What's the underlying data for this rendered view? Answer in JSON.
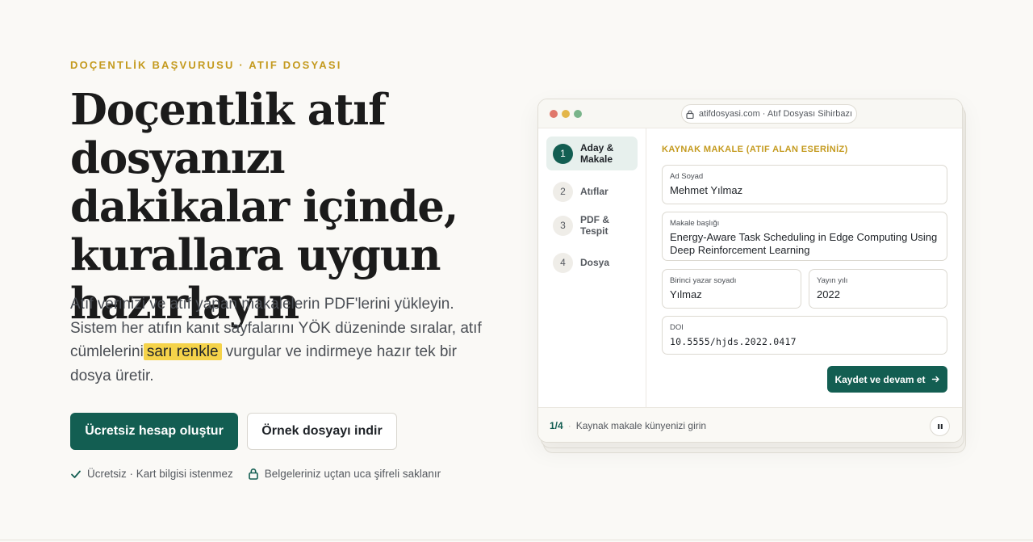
{
  "hero": {
    "eyebrow": "DOÇENTLİK BAŞVURUSU · ATIF DOSYASI",
    "headline": "Doçentlik atıf dosyanızı dakikalar içinde, kurallara uygun hazırlayın",
    "lead_before": "Atıf verinizi ve atıf yapan makalelerin PDF'lerini yükleyin. Sistem her atıfın kanıt sayfalarını YÖK düzeninde sıralar, atıf cümlelerini",
    "lead_highlight": "sarı renkle",
    "lead_after": " vurgular ve indirmeye hazır tek bir dosya üretir.",
    "primary_cta": "Ücretsiz hesap oluştur",
    "secondary_cta": "Örnek dosyayı indir",
    "trust": [
      {
        "icon": "check-icon",
        "text": "Ücretsiz · Kart bilgisi istenmez"
      },
      {
        "icon": "lock-icon",
        "text": "Belgeleriniz uçtan uca şifreli saklanır"
      }
    ],
    "highlight_color": "#f5d34a",
    "accent_color": "#135e52",
    "eyebrow_color": "#c49a1e"
  },
  "mock": {
    "url": "atifdosyasi.com · Atıf Dosyası Sihirbazı",
    "steps": [
      {
        "num": "1",
        "label": "Aday &\nMakale",
        "active": true
      },
      {
        "num": "2",
        "label": "Atıflar",
        "active": false
      },
      {
        "num": "3",
        "label": "PDF &\nTespit",
        "active": false
      },
      {
        "num": "4",
        "label": "Dosya",
        "active": false
      }
    ],
    "form_title": "KAYNAK MAKALE (ATIF ALAN ESERİNİZ)",
    "fields": {
      "name": {
        "label": "Ad Soyad",
        "value": "Mehmet Yılmaz"
      },
      "title": {
        "label": "Makale başlığı",
        "value": "Energy-Aware Task Scheduling in Edge Computing Using Deep Reinforcement Learning"
      },
      "first_author": {
        "label": "Birinci yazar soyadı",
        "value": "Yılmaz"
      },
      "year": {
        "label": "Yayın yılı",
        "value": "2022"
      },
      "doi": {
        "label": "DOI",
        "value": "10.5555/hjds.2022.0417"
      }
    },
    "save_button": "Kaydet ve devam et",
    "footer": {
      "progress": "1/4",
      "hint": "Kaynak makale künyenizi girin"
    }
  }
}
